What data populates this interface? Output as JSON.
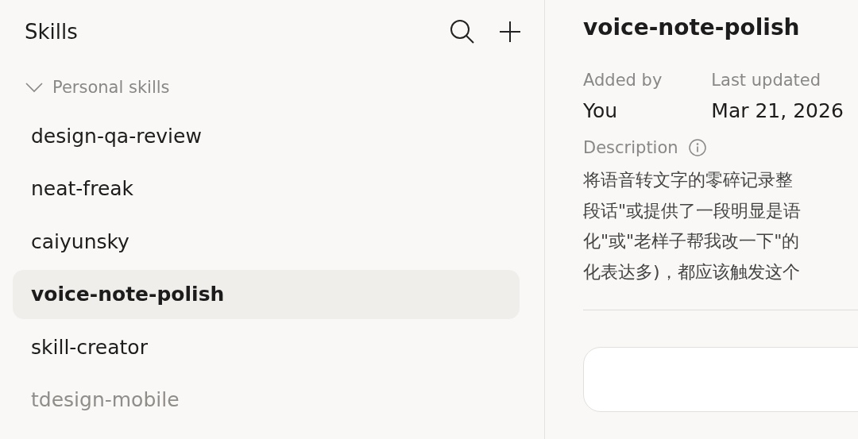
{
  "sidebar": {
    "title": "Skills",
    "section": {
      "label": "Personal skills",
      "expanded": true,
      "items": [
        {
          "label": "design-qa-review",
          "selected": false,
          "disabled": false
        },
        {
          "label": "neat-freak",
          "selected": false,
          "disabled": false
        },
        {
          "label": "caiyunsky",
          "selected": false,
          "disabled": false
        },
        {
          "label": "voice-note-polish",
          "selected": true,
          "disabled": false
        },
        {
          "label": "skill-creator",
          "selected": false,
          "disabled": false
        },
        {
          "label": "tdesign-mobile",
          "selected": false,
          "disabled": true
        }
      ]
    }
  },
  "detail": {
    "title": "voice-note-polish",
    "meta": [
      {
        "label": "Added by",
        "value": "You"
      },
      {
        "label": "Last updated",
        "value": "Mar 21, 2026"
      }
    ],
    "description_label": "Description",
    "description_lines": [
      "将语音转文字的零碎记录整",
      "段话\"或提供了一段明显是语",
      "化\"或\"老样子帮我改一下\"的",
      "化表达多)，都应该触发这个"
    ]
  }
}
